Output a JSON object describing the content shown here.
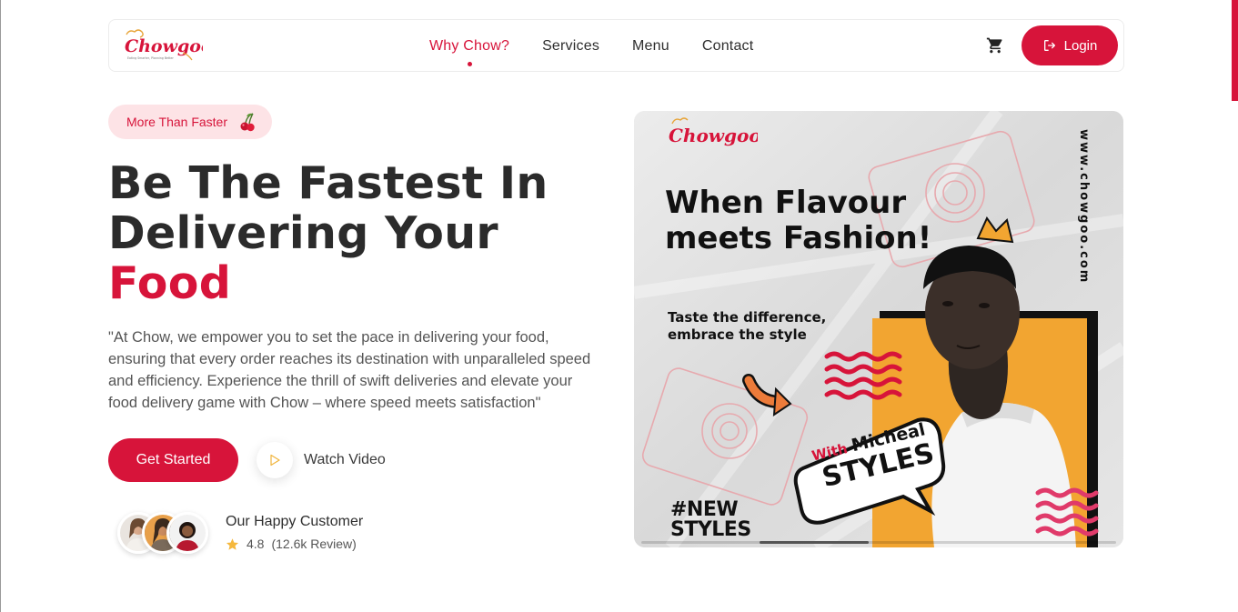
{
  "brand": {
    "name": "Chowgoo",
    "tagline": "Eating Smarter, Planning Better",
    "accent_color": "#d7143a"
  },
  "nav": {
    "links": [
      {
        "label": "Why Chow?",
        "active": true
      },
      {
        "label": "Services",
        "active": false
      },
      {
        "label": "Menu",
        "active": false
      },
      {
        "label": "Contact",
        "active": false
      }
    ],
    "cart_icon": "cart-icon",
    "login_label": "Login",
    "login_icon": "login-icon"
  },
  "hero": {
    "badge_text": "More Than Faster",
    "badge_icon": "cherry-icon",
    "title_line1": "Be The Fastest In",
    "title_line2": "Delivering Your",
    "title_accent": "Food",
    "description": "\"At Chow, we empower you to set the pace in delivering your food, ensuring that every order reaches its destination with unparalleled speed and efficiency. Experience the thrill of swift deliveries and elevate your food delivery game with Chow – where speed meets satisfaction\"",
    "cta_label": "Get Started",
    "watch_label": "Watch Video",
    "customers": {
      "title": "Our Happy Customer",
      "rating": "4.8",
      "reviews": "(12.6k Review)"
    }
  },
  "hero_image": {
    "logo_text": "Chowgoo",
    "headline": "When Flavour meets Fashion!",
    "subline": "Taste the difference, embrace the style",
    "website": "www.chowgoo.com",
    "bubble_with": "With",
    "bubble_name": "Micheal",
    "bubble_styles": "STYLES",
    "hashtag_line1": "#NEW",
    "hashtag_line2": "STYLES",
    "carousel_progress": 0.23
  }
}
